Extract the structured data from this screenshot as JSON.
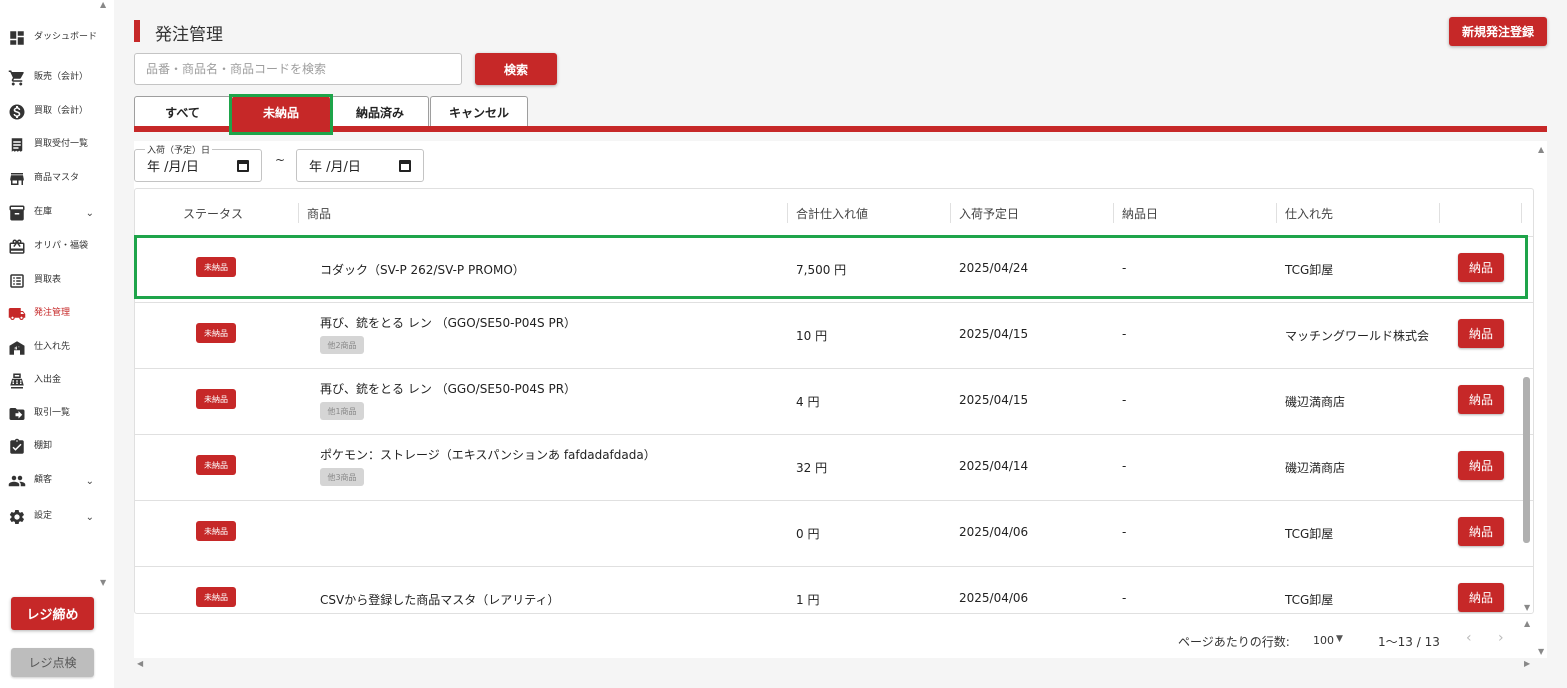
{
  "sidebar": {
    "items": [
      {
        "label": "ダッシュボード",
        "icon": "dashboard-icon"
      },
      {
        "label": "販売（会計）",
        "icon": "cart-icon"
      },
      {
        "label": "買取（会計）",
        "icon": "dollar-icon"
      },
      {
        "label": "買取受付一覧",
        "icon": "receipt-icon"
      },
      {
        "label": "商品マスタ",
        "icon": "store-icon"
      },
      {
        "label": "在庫",
        "icon": "archive-icon"
      },
      {
        "label": "オリパ・福袋",
        "icon": "gift-icon"
      },
      {
        "label": "買取表",
        "icon": "list-icon"
      },
      {
        "label": "発注管理",
        "icon": "truck-icon"
      },
      {
        "label": "仕入れ先",
        "icon": "warehouse-icon"
      },
      {
        "label": "入出金",
        "icon": "register-icon"
      },
      {
        "label": "取引一覧",
        "icon": "folder-arrow-icon"
      },
      {
        "label": "棚卸",
        "icon": "clipboard-check-icon"
      },
      {
        "label": "顧客",
        "icon": "people-icon"
      },
      {
        "label": "設定",
        "icon": "gear-icon"
      }
    ],
    "close_button": "レジ締め",
    "check_button": "レジ点検"
  },
  "header": {
    "title": "発注管理",
    "new_button": "新規発注登録",
    "search_placeholder": "品番・商品名・商品コードを検索",
    "search_button": "検索"
  },
  "tabs": [
    {
      "label": "すべて"
    },
    {
      "label": "未納品"
    },
    {
      "label": "納品済み"
    },
    {
      "label": "キャンセル"
    }
  ],
  "filter": {
    "date_label": "入荷（予定）日",
    "from_value": "年 /月/日",
    "to_value": "年 /月/日",
    "separator": "~"
  },
  "table": {
    "columns": [
      "ステータス",
      "商品",
      "合計仕入れ値",
      "入荷予定日",
      "納品日",
      "仕入れ先"
    ],
    "rows": [
      {
        "status": "未納品",
        "product": "コダック（SV-P 262/SV-P PROMO）",
        "more": "",
        "total": "7,500 円",
        "eta": "2025/04/24",
        "delivered": "-",
        "supplier": "TCG卸屋",
        "action": "納品"
      },
      {
        "status": "未納品",
        "product": "再び、銃をとる レン （GGO/SE50-P04S PR）",
        "more": "他2商品",
        "total": "10 円",
        "eta": "2025/04/15",
        "delivered": "-",
        "supplier": "マッチングワールド株式会",
        "action": "納品"
      },
      {
        "status": "未納品",
        "product": "再び、銃をとる レン （GGO/SE50-P04S PR）",
        "more": "他1商品",
        "total": "4 円",
        "eta": "2025/04/15",
        "delivered": "-",
        "supplier": "磯辺満商店",
        "action": "納品"
      },
      {
        "status": "未納品",
        "product": "ポケモン：ストレージ（エキスパンションあ fafdadafdada）",
        "more": "他3商品",
        "total": "32 円",
        "eta": "2025/04/14",
        "delivered": "-",
        "supplier": "磯辺満商店",
        "action": "納品"
      },
      {
        "status": "未納品",
        "product": "",
        "more": "",
        "total": "0 円",
        "eta": "2025/04/06",
        "delivered": "-",
        "supplier": "TCG卸屋",
        "action": "納品"
      },
      {
        "status": "未納品",
        "product": "CSVから登録した商品マスタ（レアリティ）",
        "more": "",
        "total": "1 円",
        "eta": "2025/04/06",
        "delivered": "-",
        "supplier": "TCG卸屋",
        "action": "納品"
      }
    ]
  },
  "pagination": {
    "rows_label": "ページあたりの行数:",
    "rows_value": "100",
    "range": "1〜13 / 13"
  },
  "colors": {
    "accent": "#c62828",
    "highlight": "#1ea44a"
  }
}
